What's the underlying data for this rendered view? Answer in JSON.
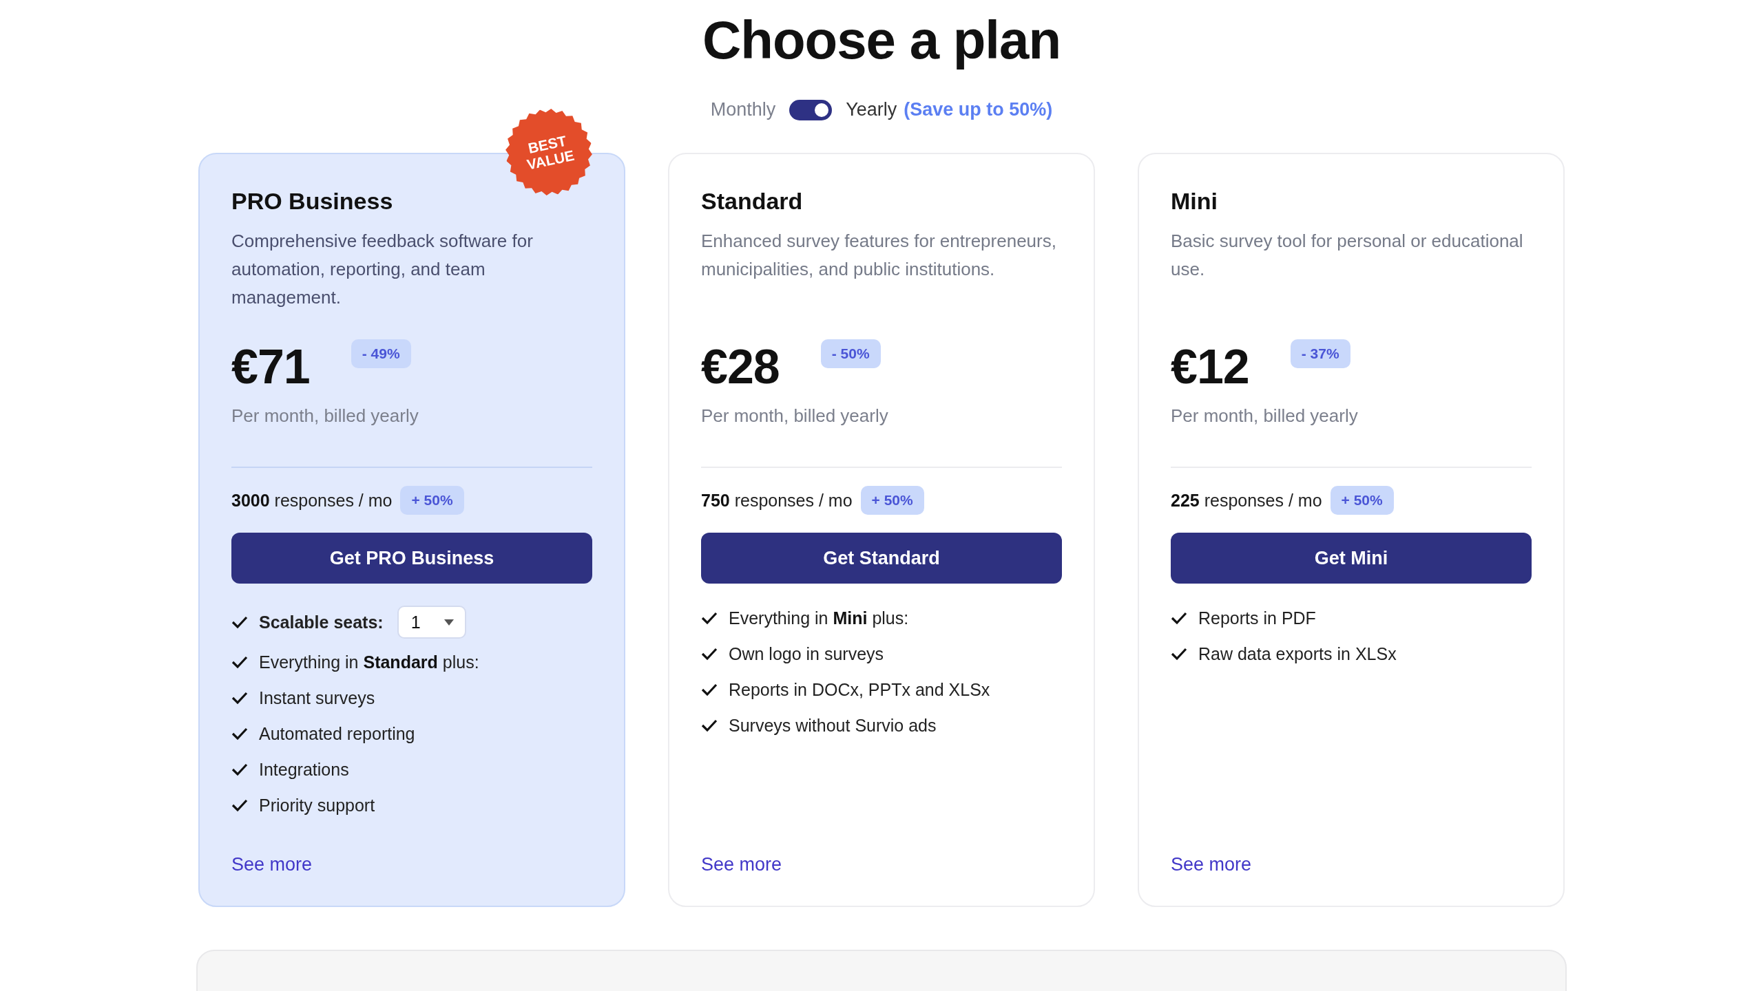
{
  "title": "Choose a plan",
  "billing": {
    "left_label": "Monthly",
    "right_label": "Yearly",
    "savings": "(Save up to 50%)",
    "on": true
  },
  "plans": [
    {
      "name": "PRO Business",
      "highlighted": true,
      "ribbon": "BEST VALUE",
      "description": "Comprehensive feedback software for automation, reporting, and team management.",
      "price": "€71",
      "discount": "- 49%",
      "period": "Per month, billed yearly",
      "responses": "**3000** responses / mo",
      "responses_bonus": "+ 50%",
      "button": "Get PRO Business",
      "features": [
        {
          "kind": "seats",
          "text": "Scalable seats:",
          "value": "1"
        },
        {
          "kind": "text",
          "text": "Everything in **Standard** plus:"
        },
        {
          "kind": "text",
          "text": "Instant surveys"
        },
        {
          "kind": "text",
          "text": "Automated reporting"
        },
        {
          "kind": "text",
          "text": "Integrations"
        },
        {
          "kind": "text",
          "text": "Priority support"
        }
      ],
      "link": "See more"
    },
    {
      "name": "Standard",
      "highlighted": false,
      "description": "Enhanced survey features for entrepreneurs, municipalities, and public institutions.",
      "price": "€28",
      "discount": "- 50%",
      "period": "Per month, billed yearly",
      "responses": "**750** responses / mo",
      "responses_bonus": "+ 50%",
      "button": "Get Standard",
      "features": [
        {
          "kind": "text",
          "text": "Everything in **Mini** plus:"
        },
        {
          "kind": "text",
          "text": "Own logo in surveys"
        },
        {
          "kind": "text",
          "text": "Reports in DOCx, PPTx and XLSx"
        },
        {
          "kind": "text",
          "text": "Surveys without Survio ads"
        }
      ],
      "link": "See more"
    },
    {
      "name": "Mini",
      "highlighted": false,
      "description": "Basic survey tool for personal or educational use.",
      "price": "€12",
      "discount": "- 37%",
      "period": "Per month, billed yearly",
      "responses": "**225** responses / mo",
      "responses_bonus": "+ 50%",
      "button": "Get Mini",
      "features": [
        {
          "kind": "text",
          "text": "Reports in PDF"
        },
        {
          "kind": "text",
          "text": "Raw data exports in XLSx"
        }
      ],
      "link": "See more"
    }
  ]
}
